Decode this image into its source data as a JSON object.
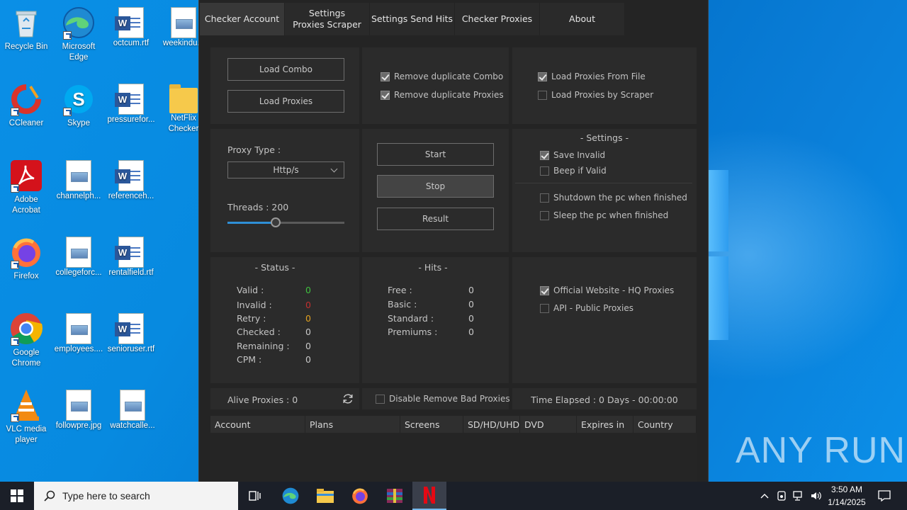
{
  "desktop": {
    "icons": [
      {
        "label": "Recycle Bin",
        "kind": "recycle"
      },
      {
        "label": "Microsoft Edge",
        "kind": "edge"
      },
      {
        "label": "octcum.rtf",
        "kind": "word"
      },
      {
        "label": "weekindu...",
        "kind": "image"
      },
      {
        "label": "CCleaner",
        "kind": "ccleaner"
      },
      {
        "label": "Skype",
        "kind": "skype"
      },
      {
        "label": "pressurefor...",
        "kind": "word"
      },
      {
        "label": "NetFlix Checker",
        "kind": "folder"
      },
      {
        "label": "Adobe Acrobat",
        "kind": "acrobat"
      },
      {
        "label": "channelph...",
        "kind": "image"
      },
      {
        "label": "referenceh...",
        "kind": "word"
      },
      {
        "label": "Firefox",
        "kind": "firefox"
      },
      {
        "label": "collegeforc...",
        "kind": "image"
      },
      {
        "label": "rentalfield.rtf",
        "kind": "word"
      },
      {
        "label": "Google Chrome",
        "kind": "chrome"
      },
      {
        "label": "employees....",
        "kind": "image"
      },
      {
        "label": "senioruser.rtf",
        "kind": "word"
      },
      {
        "label": "VLC media player",
        "kind": "vlc"
      },
      {
        "label": "followpre.jpg",
        "kind": "image"
      },
      {
        "label": "watchcalle...",
        "kind": "image"
      }
    ],
    "watermark": "ANY RUN"
  },
  "app": {
    "tabs": [
      "Checker Account",
      "Settings Proxies Scraper",
      "Settings Send Hits",
      "Checker Proxies",
      "About"
    ],
    "load_combo": "Load Combo",
    "load_proxies": "Load Proxies",
    "remove_dup_combo": "Remove duplicate Combo",
    "remove_dup_proxies": "Remove duplicate Proxies",
    "load_from_file": "Load Proxies From File",
    "load_by_scraper": "Load Proxies by Scraper",
    "proxy_type_label": "Proxy Type :",
    "proxy_type_value": "Http/s",
    "threads_label": "Threads : 200",
    "threads_fraction": 0.41,
    "start": "Start",
    "stop": "Stop",
    "result": "Result",
    "settings_title": "-  Settings  -",
    "save_invalid": "Save Invalid",
    "beep_if_valid": "Beep if Valid",
    "shutdown": "Shutdown the pc when finished",
    "sleep": "Sleep the pc when finished",
    "status_title": "-  Status  -",
    "status": [
      {
        "label": "Valid :",
        "value": "0",
        "color": "#3fbf3f"
      },
      {
        "label": "Invalid :",
        "value": "0",
        "color": "#c03030"
      },
      {
        "label": "Retry :",
        "value": "0",
        "color": "#e0a020"
      },
      {
        "label": "Checked :",
        "value": "0",
        "color": "#c8c8c8"
      },
      {
        "label": "Remaining :",
        "value": "0",
        "color": "#c8c8c8"
      },
      {
        "label": "CPM :",
        "value": "0",
        "color": "#c8c8c8"
      }
    ],
    "hits_title": "-  Hits  -",
    "hits": [
      {
        "label": "Free :",
        "value": "0"
      },
      {
        "label": "Basic :",
        "value": "0"
      },
      {
        "label": "Standard :",
        "value": "0"
      },
      {
        "label": "Premiums :",
        "value": "0"
      }
    ],
    "official_website": "Official Website - HQ Proxies",
    "api_public": "API - Public Proxies",
    "alive_proxies": "Alive Proxies : 0",
    "disable_remove": "Disable Remove Bad Proxies",
    "time_elapsed": "Time Elapsed : 0 Days - 00:00:00",
    "columns": [
      "Account",
      "Plans",
      "Screens",
      "SD/HD/UHD",
      "DVD",
      "Expires in",
      "Country"
    ]
  },
  "taskbar": {
    "search_placeholder": "Type here to search",
    "time": "3:50 AM",
    "date": "1/14/2025"
  }
}
